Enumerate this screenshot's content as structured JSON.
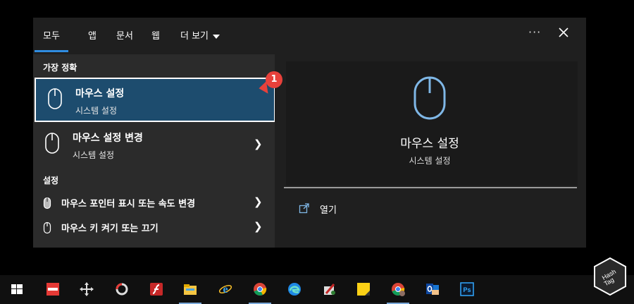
{
  "tabs": [
    {
      "label": "모두",
      "active": true
    },
    {
      "label": "앱"
    },
    {
      "label": "문서"
    },
    {
      "label": "웹"
    },
    {
      "label": "더 보기"
    }
  ],
  "header": {
    "more_options": "···"
  },
  "best_match": {
    "heading": "가장 정확",
    "items": [
      {
        "title": "마우스 설정",
        "subtitle": "시스템 설정",
        "icon": "mouse-icon",
        "selected": true
      },
      {
        "title": "마우스 설정 변경",
        "subtitle": "시스템 설정",
        "icon": "mouse-icon"
      }
    ]
  },
  "settings": {
    "heading": "설정",
    "items": [
      {
        "label": "마우스 포인터 표시 또는 속도 변경",
        "icon": "mouse-pointer-icon"
      },
      {
        "label": "마우스 키 켜기 또는 끄기",
        "icon": "mouse-icon"
      }
    ]
  },
  "preview": {
    "title": "마우스 설정",
    "subtitle": "시스템 설정",
    "actions": [
      {
        "label": "열기",
        "icon": "open-icon"
      }
    ]
  },
  "annotation": {
    "badge_number": "1",
    "color": "#e8413b"
  },
  "colors": {
    "accent": "#2f8ce0",
    "selected_bg": "#1d4c6e",
    "icon_blue": "#7fb7e6"
  },
  "taskbar": {
    "items": [
      "windows-start-icon",
      "app-red-icon",
      "move-tool-icon",
      "circle-app-icon",
      "flash-icon",
      "file-explorer-icon",
      "internet-explorer-icon",
      "chrome-icon",
      "edge-icon",
      "paint-icon",
      "sticky-notes-icon",
      "chrome-profile-icon",
      "outlook-icon",
      "photoshop-icon"
    ]
  },
  "watermark": {
    "text": "Hash Tag"
  }
}
